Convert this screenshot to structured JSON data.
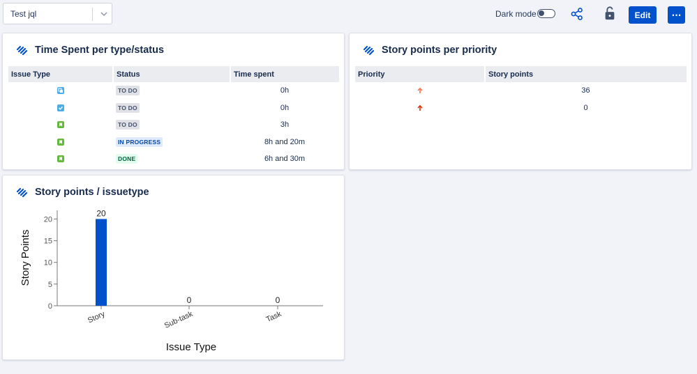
{
  "toolbar": {
    "filter_value": "Test jql",
    "dark_mode_label": "Dark mode",
    "edit_label": "Edit",
    "more_label": "···",
    "icons": [
      "chevron-down-icon",
      "share-icon",
      "unlock-icon"
    ],
    "accent_color": "#0052cc"
  },
  "time_spent": {
    "title": "Time Spent per type/status",
    "columns": [
      "Issue Type",
      "Status",
      "Time spent"
    ],
    "rows": [
      {
        "type": "subtask",
        "status": "TO DO",
        "time": "0h"
      },
      {
        "type": "task",
        "status": "TO DO",
        "time": "0h"
      },
      {
        "type": "story",
        "status": "TO DO",
        "time": "3h"
      },
      {
        "type": "story",
        "status": "IN PROGRESS",
        "time": "8h and 20m"
      },
      {
        "type": "story",
        "status": "DONE",
        "time": "6h and 30m"
      }
    ]
  },
  "priority": {
    "title": "Story points per priority",
    "columns": [
      "Priority",
      "Story points"
    ],
    "rows": [
      {
        "priority": "high",
        "color": "#ff7452",
        "points": "36"
      },
      {
        "priority": "highest",
        "color": "#de350b",
        "points": "0"
      }
    ]
  },
  "chart": {
    "title": "Story points / issuetype"
  },
  "chart_data": {
    "type": "bar",
    "title": "Story points / issuetype",
    "xlabel": "Issue Type",
    "ylabel": "Story Points",
    "categories": [
      "Story",
      "Sub-task",
      "Task"
    ],
    "values": [
      20,
      0,
      0
    ],
    "ylim": [
      0,
      22
    ],
    "yticks": [
      0,
      5,
      10,
      15,
      20
    ],
    "bar_color": "#0052cc",
    "grid": false
  }
}
